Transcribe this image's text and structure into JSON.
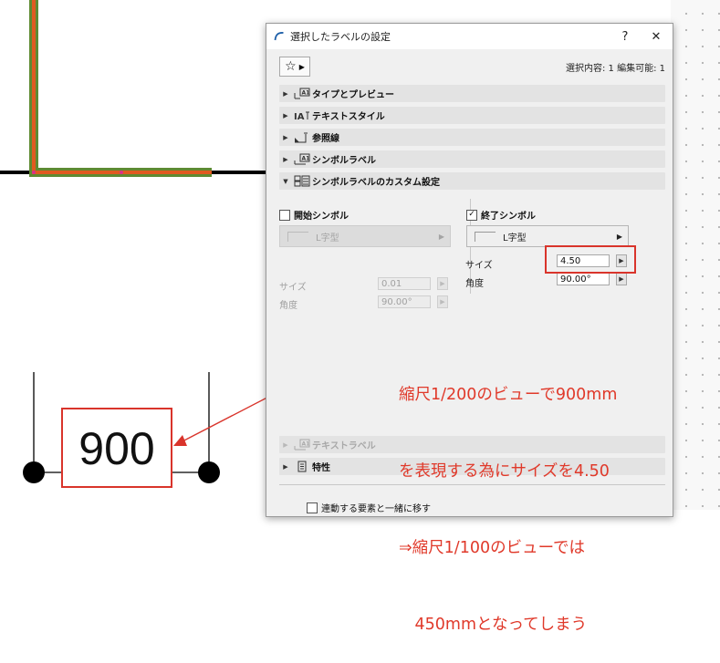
{
  "drawing": {
    "dimension_text": "900"
  },
  "dialog": {
    "title": "選択したラベルの設定",
    "help_label": "?",
    "close_label": "✕",
    "favorites_icon": "star-icon",
    "selection_info": "選択内容: 1 編集可能: 1",
    "sections": [
      {
        "label": "タイプとプレビュー",
        "icon": "label-type-icon",
        "expanded": false,
        "enabled": true
      },
      {
        "label": "テキストスタイル",
        "icon": "text-style-icon",
        "expanded": false,
        "enabled": true
      },
      {
        "label": "参照線",
        "icon": "pointer-line-icon",
        "expanded": false,
        "enabled": true
      },
      {
        "label": "シンボルラベル",
        "icon": "symbol-label-icon",
        "expanded": false,
        "enabled": true
      },
      {
        "label": "シンボルラベルのカスタム設定",
        "icon": "custom-settings-icon",
        "expanded": true,
        "enabled": true
      }
    ],
    "custom": {
      "start": {
        "label": "開始シンボル",
        "checked": false,
        "type_value": "L字型",
        "size_label": "サイズ",
        "size_value": "0.01",
        "angle_label": "角度",
        "angle_value": "90.00°"
      },
      "end": {
        "label": "終了シンボル",
        "checked": true,
        "check_mark": "✓",
        "type_value": "L字型",
        "size_label": "サイズ",
        "size_value": "4.50",
        "angle_label": "角度",
        "angle_value": "90.00°"
      }
    },
    "lower_sections": [
      {
        "label": "テキストラベル",
        "icon": "text-label-icon",
        "enabled": false
      },
      {
        "label": "特性",
        "icon": "properties-icon",
        "enabled": true
      }
    ],
    "bottom_checkbox_label": "連動する要素と一緒に移す"
  },
  "annotation": {
    "text_lines": [
      "縮尺1/200のビューで900mm",
      "を表現する為にサイズを4.50",
      "⇒縮尺1/100のビューでは",
      "　450mmとなってしまう"
    ],
    "color": "#e0392a"
  },
  "colors": {
    "wall_outline": "#5e8a32",
    "wall_highlight": "#e05a20",
    "dialog_bg": "#f0f0f0",
    "section_bg": "#e3e3e3"
  }
}
